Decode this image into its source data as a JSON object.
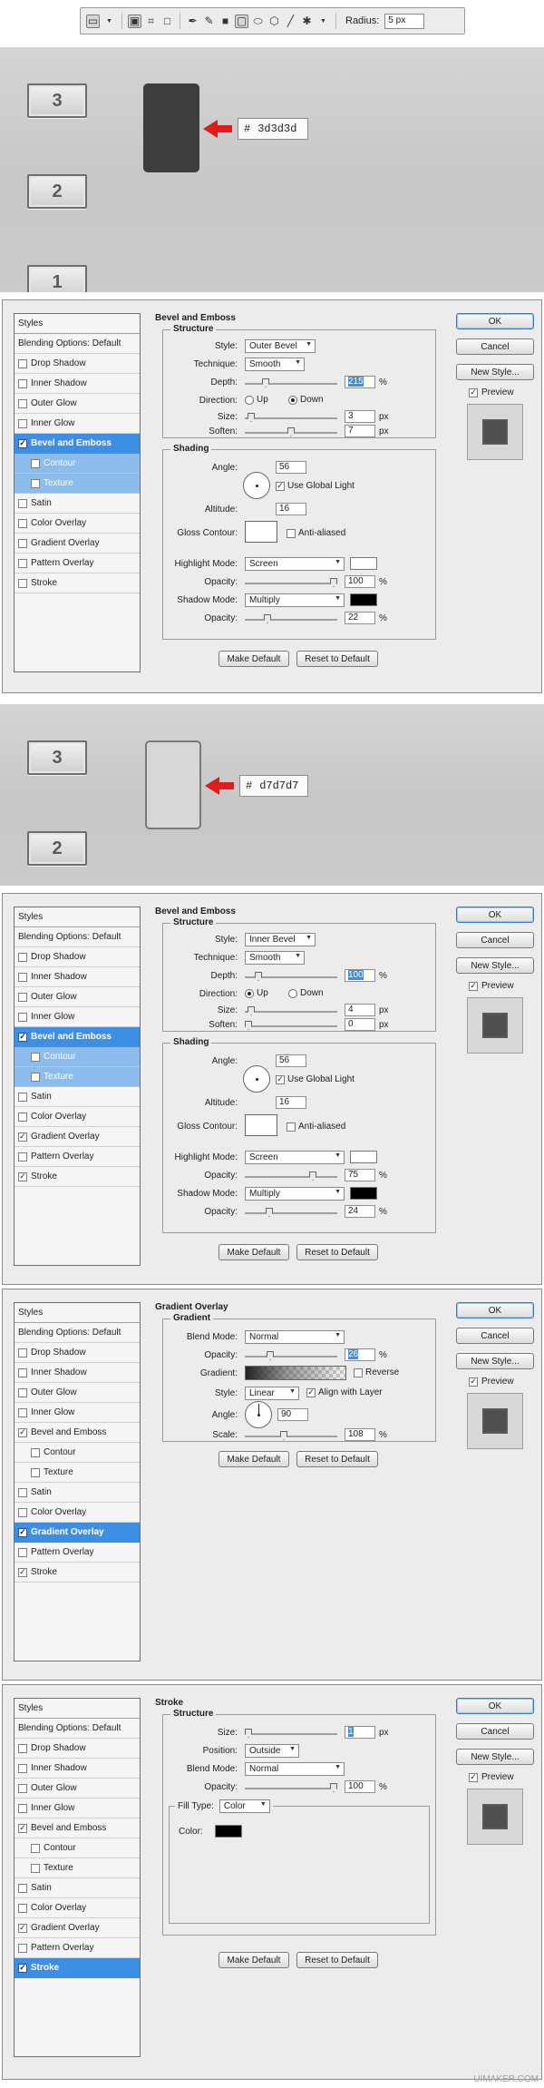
{
  "toolbar": {
    "radius_label": "Radius:",
    "radius_value": "5 px",
    "icons": [
      "rectangle-icon",
      "dropdown-icon",
      "shape-layers-icon",
      "paths-icon",
      "fill-pixels-icon",
      "pen-icon",
      "freeform-pen-icon",
      "rectangle-tool-icon",
      "rounded-rectangle-icon",
      "ellipse-icon",
      "polygon-icon",
      "line-icon",
      "custom-shape-icon",
      "dropdown-icon"
    ]
  },
  "scene1": {
    "keys": [
      "3",
      "2",
      "1"
    ],
    "swatch_color": "#3d3d3d",
    "hex_hash": "#",
    "hex_value": "3d3d3d"
  },
  "scene2": {
    "keys": [
      "3",
      "2"
    ],
    "swatch_color": "#d7d7d7",
    "hex_hash": "#",
    "hex_value": "d7d7d7"
  },
  "common": {
    "styles_header": "Styles",
    "blending": "Blending Options: Default",
    "ok": "OK",
    "cancel": "Cancel",
    "new_style": "New Style...",
    "preview": "Preview",
    "make_default": "Make Default",
    "reset_default": "Reset to Default"
  },
  "styles_items": [
    {
      "label": "Drop Shadow",
      "sub": false
    },
    {
      "label": "Inner Shadow",
      "sub": false
    },
    {
      "label": "Outer Glow",
      "sub": false
    },
    {
      "label": "Inner Glow",
      "sub": false
    },
    {
      "label": "Bevel and Emboss",
      "sub": false
    },
    {
      "label": "Contour",
      "sub": true
    },
    {
      "label": "Texture",
      "sub": true
    },
    {
      "label": "Satin",
      "sub": false
    },
    {
      "label": "Color Overlay",
      "sub": false
    },
    {
      "label": "Gradient Overlay",
      "sub": false
    },
    {
      "label": "Pattern Overlay",
      "sub": false
    },
    {
      "label": "Stroke",
      "sub": false
    }
  ],
  "panels": [
    {
      "type": "bevel",
      "selected": 4,
      "checked": [
        4
      ],
      "title": "Bevel and Emboss",
      "structure": "Structure",
      "style_label": "Style:",
      "style": "Outer Bevel",
      "technique_label": "Technique:",
      "technique": "Smooth",
      "depth_label": "Depth:",
      "depth": "215",
      "depth_unit": "%",
      "direction_label": "Direction:",
      "up": "Up",
      "down": "Down",
      "direction": "down",
      "size_label": "Size:",
      "size": "3",
      "size_unit": "px",
      "soften_label": "Soften:",
      "soften": "7",
      "soften_unit": "px",
      "shading": "Shading",
      "angle_label": "Angle:",
      "angle": "56",
      "use_global": "Use Global Light",
      "altitude_label": "Altitude:",
      "altitude": "16",
      "gloss_label": "Gloss Contour:",
      "anti_aliased": "Anti-aliased",
      "highlight_label": "Highlight Mode:",
      "highlight": "Screen",
      "highlight_color": "#ffffff",
      "opacity_label": "Opacity:",
      "hl_opacity": "100",
      "shadow_label": "Shadow Mode:",
      "shadow": "Multiply",
      "shadow_color": "#000000",
      "sh_opacity": "22",
      "pct": "%"
    },
    {
      "type": "bevel",
      "selected": 4,
      "checked": [
        4,
        9,
        11
      ],
      "title": "Bevel and Emboss",
      "structure": "Structure",
      "style_label": "Style:",
      "style": "Inner Bevel",
      "technique_label": "Technique:",
      "technique": "Smooth",
      "depth_label": "Depth:",
      "depth": "100",
      "depth_unit": "%",
      "direction_label": "Direction:",
      "up": "Up",
      "down": "Down",
      "direction": "up",
      "size_label": "Size:",
      "size": "4",
      "size_unit": "px",
      "soften_label": "Soften:",
      "soften": "0",
      "soften_unit": "px",
      "shading": "Shading",
      "angle_label": "Angle:",
      "angle": "56",
      "use_global": "Use Global Light",
      "altitude_label": "Altitude:",
      "altitude": "16",
      "gloss_label": "Gloss Contour:",
      "anti_aliased": "Anti-aliased",
      "highlight_label": "Highlight Mode:",
      "highlight": "Screen",
      "highlight_color": "#ffffff",
      "opacity_label": "Opacity:",
      "hl_opacity": "75",
      "shadow_label": "Shadow Mode:",
      "shadow": "Multiply",
      "shadow_color": "#000000",
      "sh_opacity": "24",
      "pct": "%"
    },
    {
      "type": "gradient",
      "selected": 9,
      "checked": [
        4,
        9,
        11
      ],
      "title": "Gradient Overlay",
      "gradient_legend": "Gradient",
      "blend_label": "Blend Mode:",
      "blend": "Normal",
      "opacity_label": "Opacity:",
      "opacity": "26",
      "pct": "%",
      "gradient_label": "Gradient:",
      "reverse": "Reverse",
      "style_label": "Style:",
      "style": "Linear",
      "align": "Align with Layer",
      "angle_label": "Angle:",
      "angle": "90",
      "scale_label": "Scale:",
      "scale": "108"
    },
    {
      "type": "stroke",
      "selected": 11,
      "checked": [
        4,
        9,
        11
      ],
      "title": "Stroke",
      "structure": "Structure",
      "size_label": "Size:",
      "size": "1",
      "size_unit": "px",
      "position_label": "Position:",
      "position": "Outside",
      "blend_label": "Blend Mode:",
      "blend": "Normal",
      "opacity_label": "Opacity:",
      "opacity": "100",
      "pct": "%",
      "fill_label": "Fill Type:",
      "fill": "Color",
      "color_label": "Color:",
      "color": "#000000"
    }
  ],
  "watermark": "UIMAKER.COM"
}
